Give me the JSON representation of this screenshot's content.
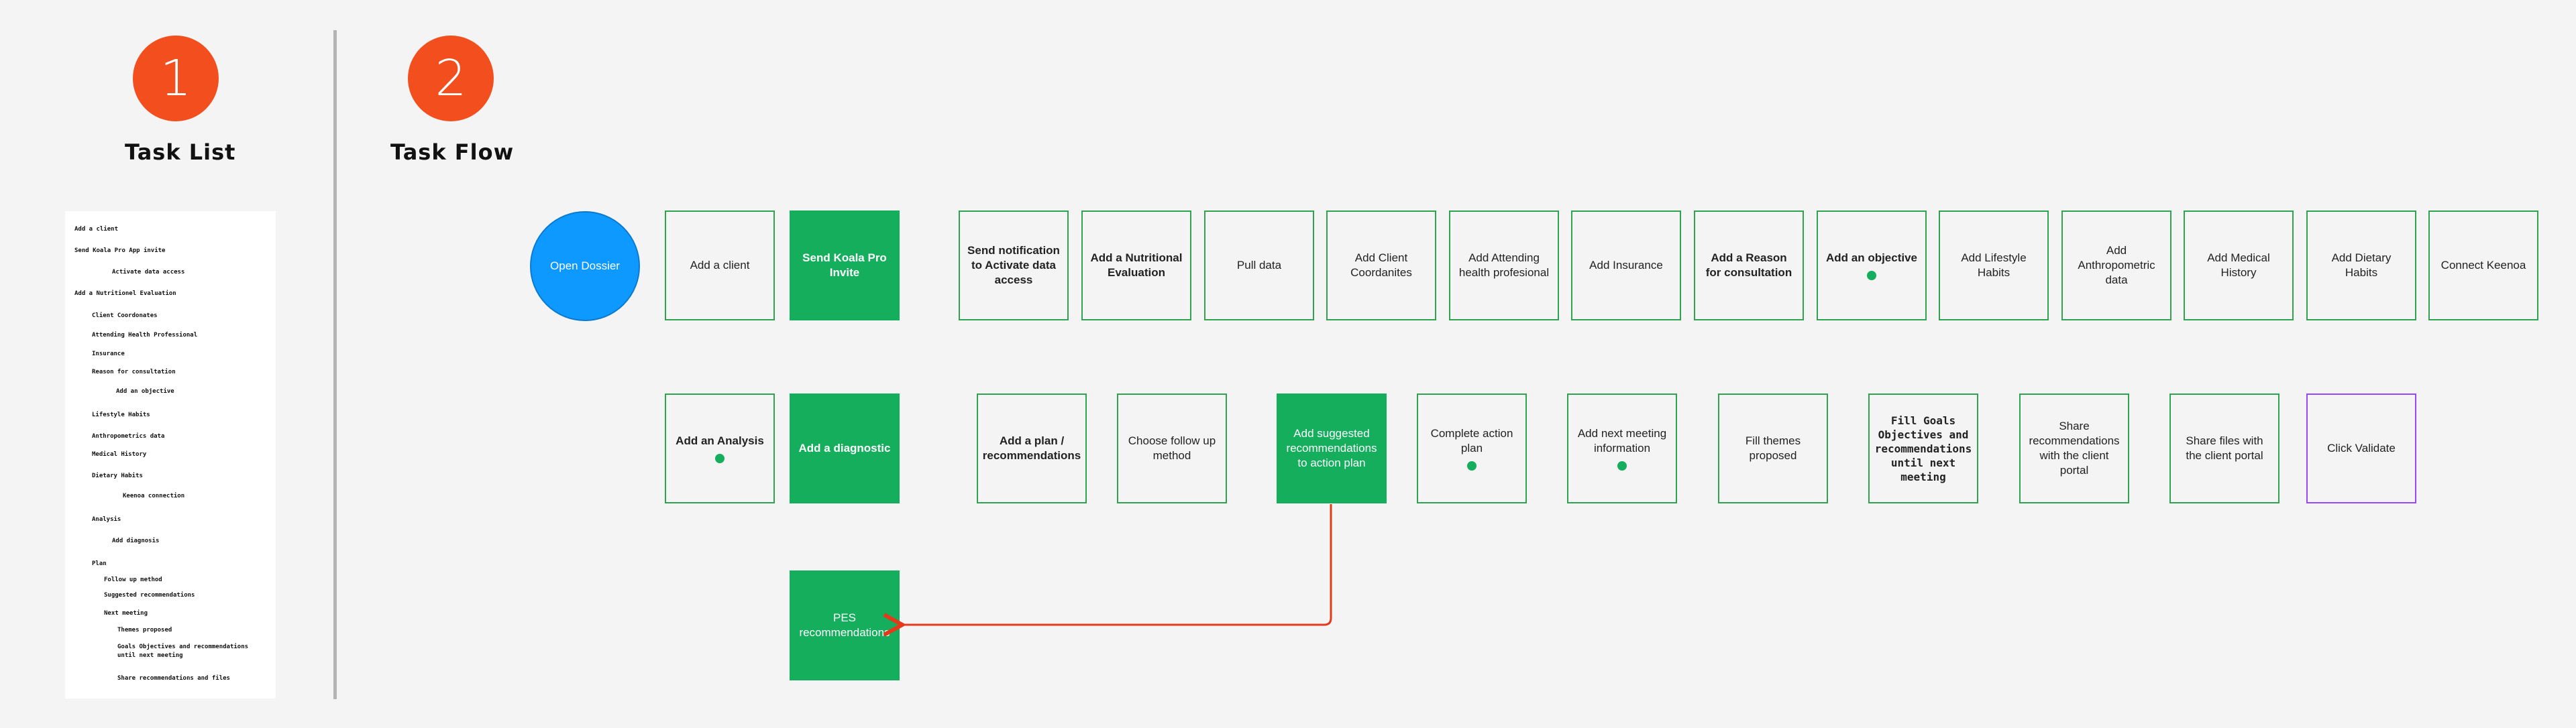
{
  "sections": {
    "task_list": {
      "number": "1",
      "title": "Task List"
    },
    "task_flow": {
      "number": "2",
      "title": "Task Flow"
    }
  },
  "task_list_lines": [
    "Add a client",
    "Send Koala Pro App invite",
    "Activate data access",
    "Add a Nutritionel Evaluation",
    "Client Coordonates",
    "Attending Health Professional",
    "Insurance",
    "Reason for consultation",
    "Add an objective",
    "Lifestyle Habits",
    "Anthropometrics data",
    "Medical History",
    "Dietary Habits",
    "Keenoa connection",
    "Analysis",
    "Add diagnosis",
    "Plan",
    "Follow up method",
    "Suggested recommendations",
    "Next meeting",
    "Themes proposed",
    "Goals Objectives and recommendations",
    "until next meeting",
    "Share recommendations and files"
  ],
  "flow": {
    "start": "Open Dossier",
    "row1": [
      "Add a client",
      "Send Koala Pro Invite",
      "Send notification to Activate data access",
      "Add a Nutritional Evaluation",
      "Pull data",
      "Add Client Coordanites",
      "Add Attending health profesional",
      "Add Insurance",
      "Add a Reason for consultation",
      "Add an objective",
      "Add Lifestyle Habits",
      "Add Anthropometric data",
      "Add Medical History",
      "Add Dietary Habits",
      "Connect Keenoa"
    ],
    "row2": [
      "Add an Analysis",
      "Add a diagnostic",
      "Add a plan / recommendations",
      "Choose follow up method",
      "Add suggested recommendations to action plan",
      "Complete action plan",
      "Add next meeting information",
      "Fill themes proposed",
      "Fill Goals Objectives and recommendations until next meeting",
      "Share recommendations with the client portal",
      "Share files with the client portal",
      "Click Validate"
    ],
    "row3": [
      "PES recommendations"
    ]
  },
  "colors": {
    "badge": "#f24e1e",
    "green": "#14ae5c",
    "blue": "#0d99ff",
    "purple": "#9747ff",
    "connector": "#e5391c"
  }
}
